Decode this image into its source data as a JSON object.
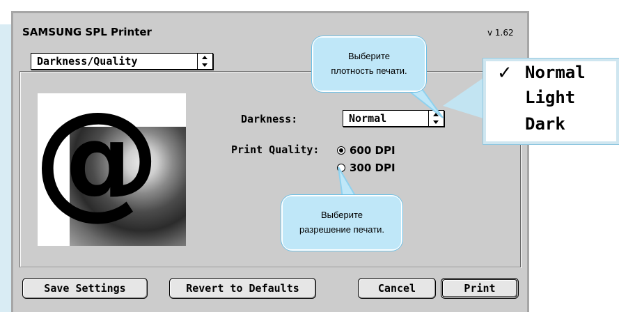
{
  "dialog": {
    "title": "SAMSUNG SPL Printer",
    "version": "v 1.62",
    "section_popup": "Darkness/Quality",
    "darkness_label": "Darkness:",
    "darkness_value": "Normal",
    "print_quality_label": "Print Quality:",
    "quality_options": [
      {
        "label": "600 DPI",
        "selected": true
      },
      {
        "label": "300 DPI",
        "selected": false
      }
    ]
  },
  "buttons": {
    "save": "Save Settings",
    "revert": "Revert to Defaults",
    "cancel": "Cancel",
    "print": "Print"
  },
  "callouts": {
    "darkness_line1": "Выберите",
    "darkness_line2": "плотность печати.",
    "resolution_line1": "Выберите",
    "resolution_line2": "разрешение печати."
  },
  "darkness_menu": {
    "items": [
      "Normal",
      "Light",
      "Dark"
    ],
    "checked": "Normal"
  },
  "colors": {
    "dialog_bg": "#cccccc",
    "callout": "#bfe7f8",
    "callout_border": "#8fd1ee"
  },
  "icons": [
    "at-sign-icon",
    "check-icon",
    "popup-arrows-icon",
    "radio-button-icon"
  ]
}
